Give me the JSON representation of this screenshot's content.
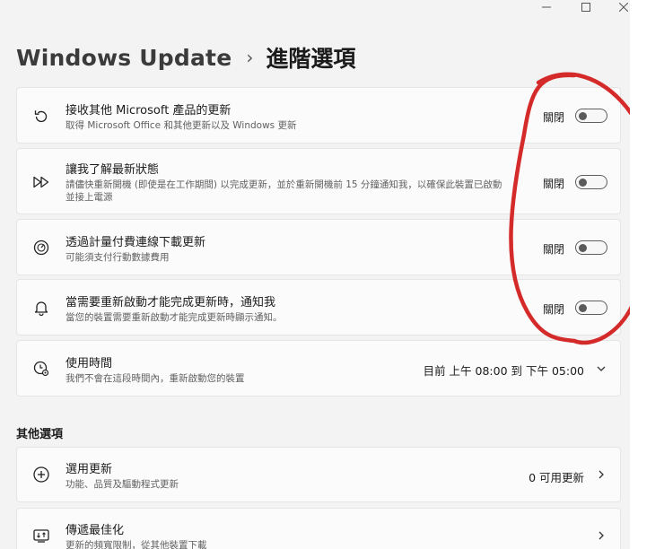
{
  "window": {
    "buttons": {
      "minimize": "minimize-icon",
      "maximize": "maximize-icon",
      "close": "close-icon"
    }
  },
  "header": {
    "parent": "Windows Update",
    "separator": "›",
    "current": "進階選項"
  },
  "cards": [
    {
      "icon": "refresh-icon",
      "title": "接收其他 Microsoft 產品的更新",
      "desc": "取得 Microsoft Office 和其他更新以及 Windows 更新",
      "state": "關閉",
      "toggle_on": false
    },
    {
      "icon": "fast-forward-icon",
      "title": "讓我了解最新狀態",
      "desc": "請儘快重新開機 (即使是在工作期間) 以完成更新，並於重新開機前 15 分鐘通知我，以確保此裝置已啟動並接上電源",
      "state": "關閉",
      "toggle_on": false
    },
    {
      "icon": "gauge-icon",
      "title": "透過計量付費連線下載更新",
      "desc": "可能須支付行動數據費用",
      "state": "關閉",
      "toggle_on": false
    },
    {
      "icon": "bell-icon",
      "title": "當需要重新啟動才能完成更新時，通知我",
      "desc": "當您的裝置需要重新啟動才能完成更新時顯示通知。",
      "state": "關閉",
      "toggle_on": false
    },
    {
      "icon": "clock-gear-icon",
      "title": "使用時間",
      "desc": "我們不會在這段時間內，重新啟動您的裝置",
      "value": "目前 上午 08:00 到 下午 05:00"
    }
  ],
  "other_section": {
    "label": "其他選項",
    "items": [
      {
        "icon": "plus-circle-icon",
        "title": "選用更新",
        "desc": "功能、品質及驅動程式更新",
        "value": "0 可用更新"
      },
      {
        "icon": "delivery-optimization-icon",
        "title": "傳遞最佳化",
        "desc": "更新的頻寬限制，從其他裝置下載"
      }
    ]
  },
  "colors": {
    "annotation": "#d42a2a",
    "background": "#f3f3f3",
    "card": "#fbfbfb"
  }
}
